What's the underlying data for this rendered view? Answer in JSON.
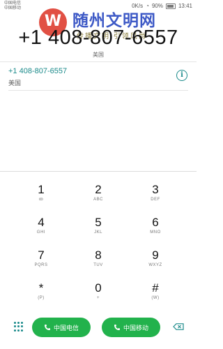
{
  "status": {
    "carrier_1": "中国电信",
    "carrier_2": "中国移动",
    "right_text": "0K/s",
    "battery": "90%",
    "time": "13:41"
  },
  "watermark": {
    "logo_char": "W",
    "title": "随州文明网",
    "subtitle": "传播文明 引领风尚"
  },
  "dial": {
    "number": "+1 408-807-6557",
    "region": "美国"
  },
  "suggestion": {
    "number": "+1 408-807-6557",
    "region": "美国",
    "info_label": "i"
  },
  "keys": [
    {
      "digit": "1",
      "letters": "ꝏ"
    },
    {
      "digit": "2",
      "letters": "ABC"
    },
    {
      "digit": "3",
      "letters": "DEF"
    },
    {
      "digit": "4",
      "letters": "GHI"
    },
    {
      "digit": "5",
      "letters": "JKL"
    },
    {
      "digit": "6",
      "letters": "MNO"
    },
    {
      "digit": "7",
      "letters": "PQRS"
    },
    {
      "digit": "8",
      "letters": "TUV"
    },
    {
      "digit": "9",
      "letters": "WXYZ"
    },
    {
      "digit": "*",
      "letters": "(P)"
    },
    {
      "digit": "0",
      "letters": "+"
    },
    {
      "digit": "#",
      "letters": "(W)"
    }
  ],
  "calls": {
    "sim1_label": "中国电信",
    "sim2_label": "中国移动"
  },
  "colors": {
    "accent": "#1a8a8a",
    "call_green": "#22b24c"
  }
}
